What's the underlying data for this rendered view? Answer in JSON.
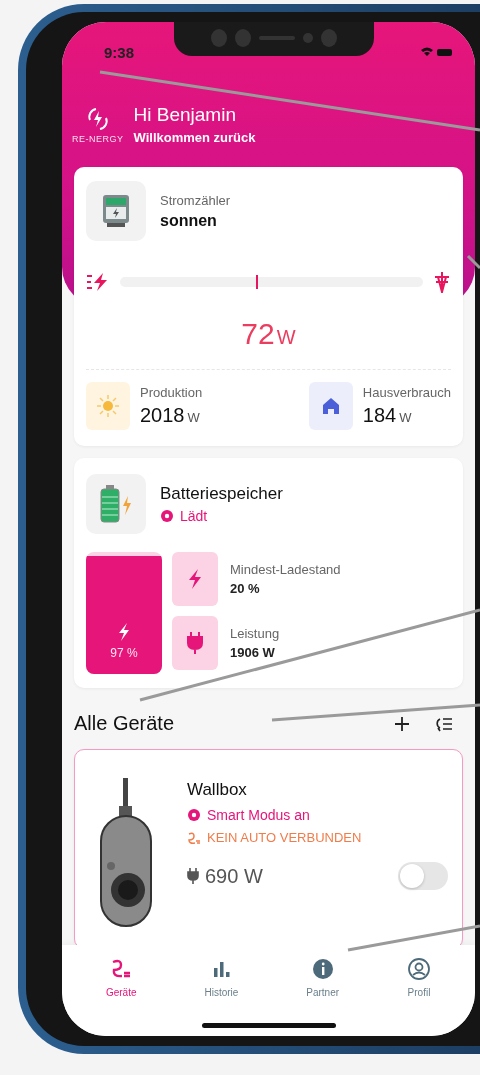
{
  "status_bar": {
    "time": "9:38"
  },
  "header": {
    "logo_text": "RE-NERGY",
    "greeting": "Hi Benjamin",
    "subtitle": "Willkommen zurück"
  },
  "meter_card": {
    "label": "Stromzähler",
    "name": "sonnen",
    "level": 0.45,
    "value": "72",
    "unit": "W",
    "stats": [
      {
        "kind": "production",
        "label": "Produktion",
        "value": "2018",
        "unit": "W"
      },
      {
        "kind": "house",
        "label": "Hausverbrauch",
        "value": "184",
        "unit": "W"
      }
    ]
  },
  "battery_card": {
    "title": "Batteriespeicher",
    "status": "Lädt",
    "level": 0.97,
    "charge": "97 %",
    "details": [
      {
        "kind": "bolt",
        "label": "Mindest-Ladestand",
        "value": "20 %"
      },
      {
        "kind": "plug",
        "label": "Leistung",
        "value": "1906 W"
      }
    ]
  },
  "devices": {
    "title": "Alle Geräte",
    "items": [
      {
        "name": "Wallbox",
        "mode": "Smart Modus an",
        "car_status": "KEIN AUTO VERBUNDEN",
        "power": "690 W",
        "on": false
      }
    ]
  },
  "nav": [
    {
      "kind": "devices",
      "label": "Geräte",
      "selected": true
    },
    {
      "kind": "history",
      "label": "Historie",
      "selected": false
    },
    {
      "kind": "partner",
      "label": "Partner",
      "selected": false
    },
    {
      "kind": "profile",
      "label": "Profil",
      "selected": false
    }
  ]
}
